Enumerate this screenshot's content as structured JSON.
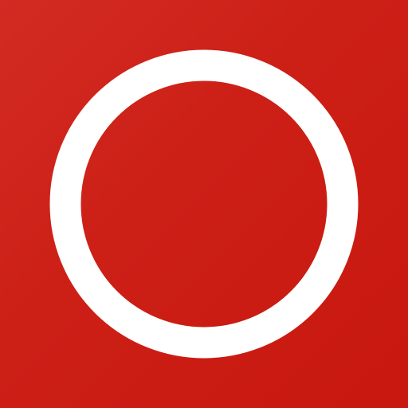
{
  "app_icon": {
    "icon": "circle-outline-icon",
    "background_color": "#cc1f16",
    "gradient_start_color": "#d22b22",
    "gradient_end_color": "#c8180f",
    "ring_color": "#ffffff"
  }
}
